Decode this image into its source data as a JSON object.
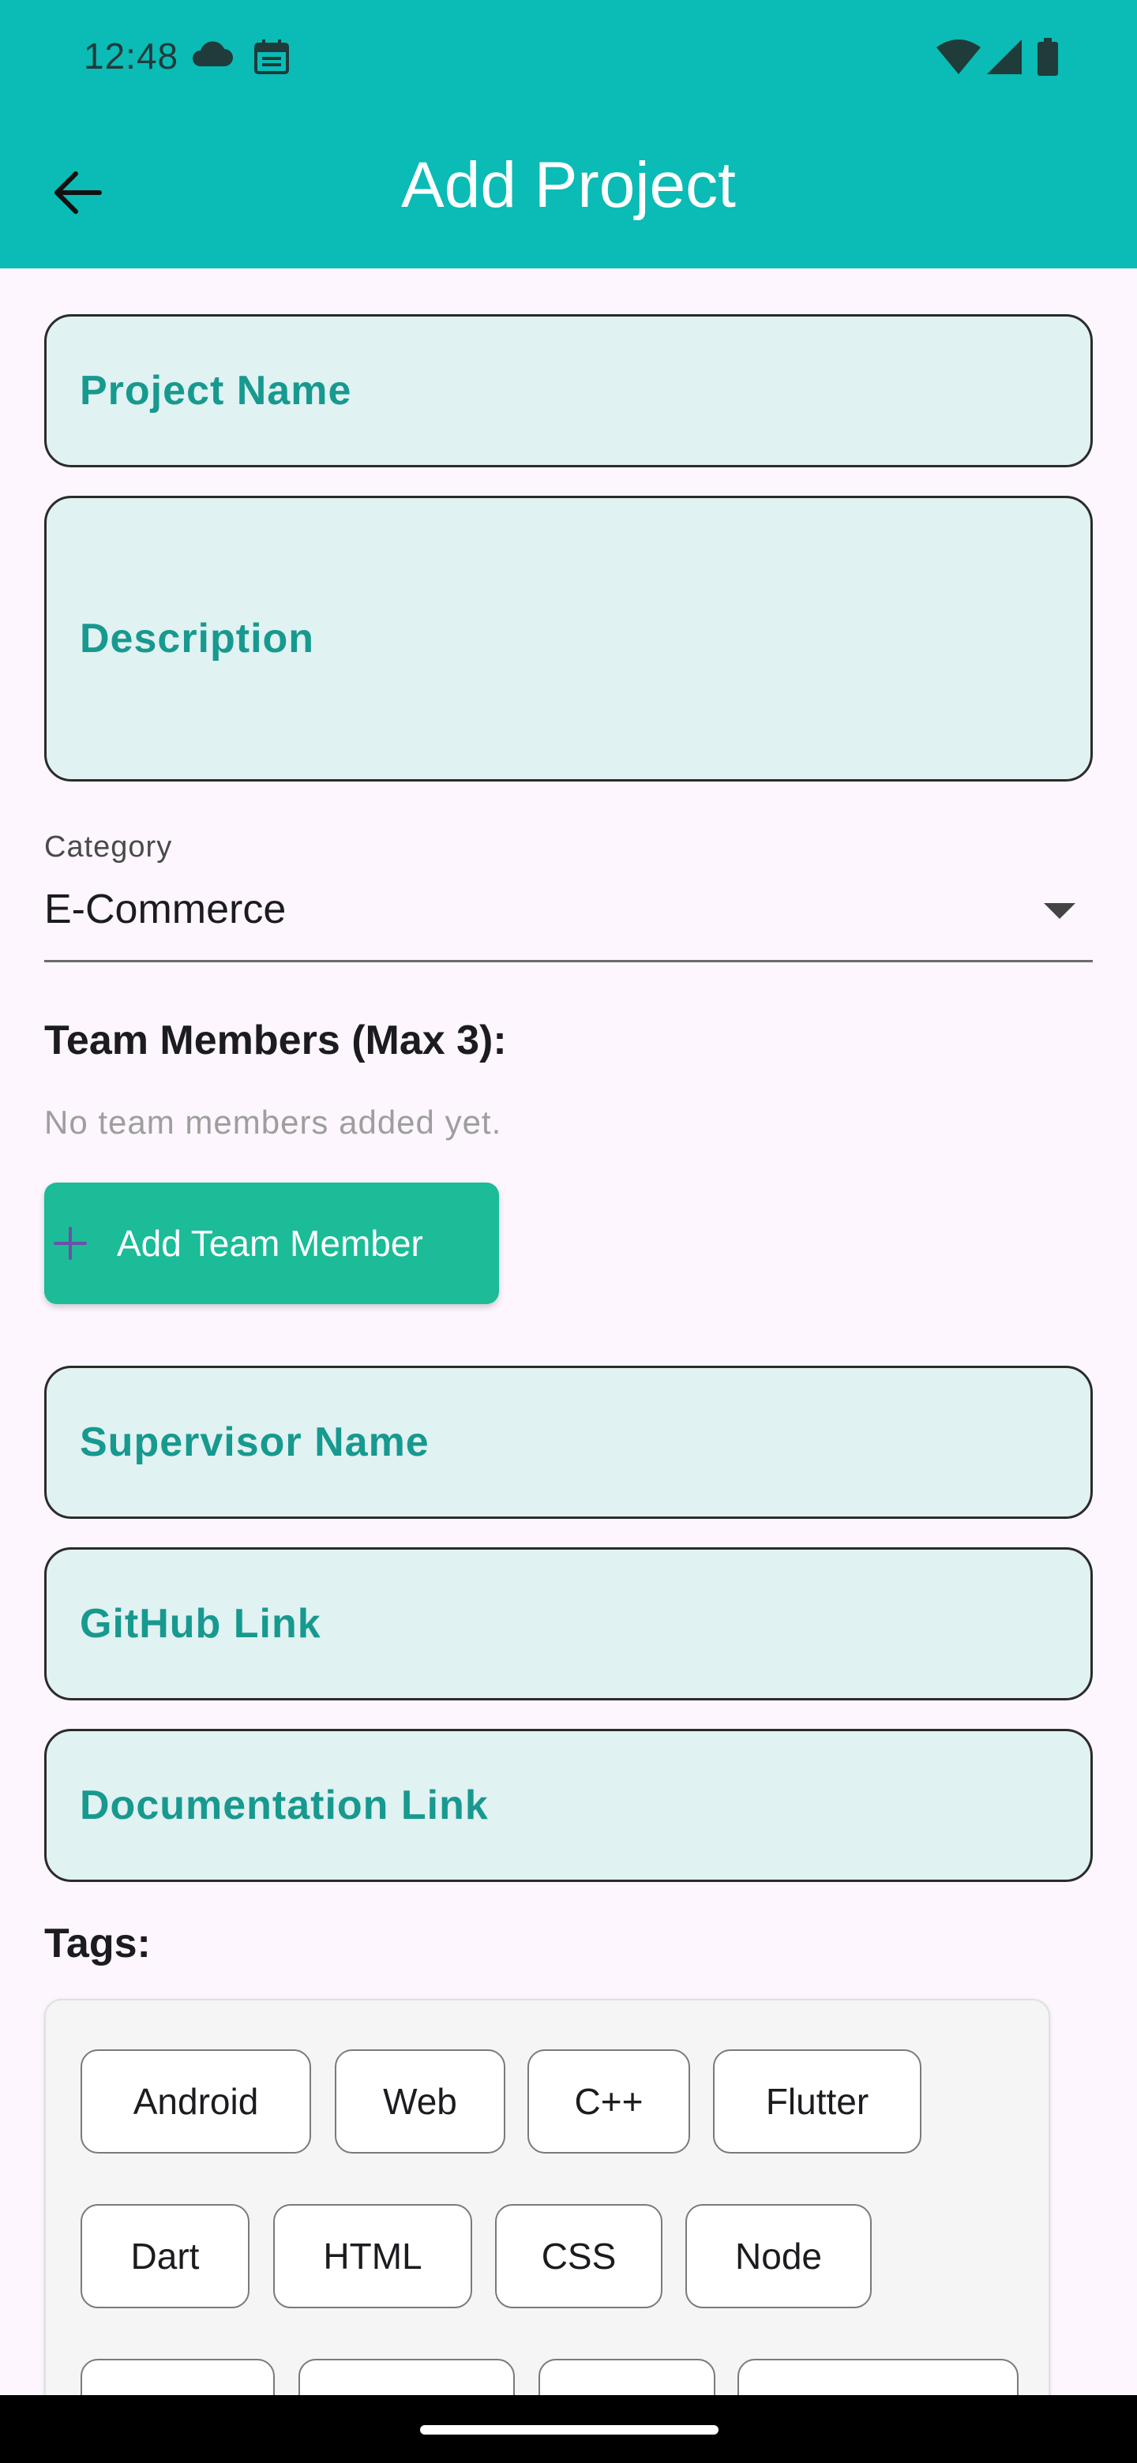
{
  "status_bar": {
    "time": "12:48"
  },
  "app_bar": {
    "title": "Add Project"
  },
  "form": {
    "project_name_label": "Project Name",
    "description_label": "Description",
    "category": {
      "label": "Category",
      "value": "E-Commerce"
    },
    "team": {
      "title": "Team Members (Max 3):",
      "empty_text": "No team members added yet.",
      "add_button": "Add Team Member"
    },
    "supervisor_label": "Supervisor Name",
    "github_label": "GitHub Link",
    "docs_label": "Documentation Link",
    "tags": {
      "title": "Tags:",
      "items": [
        "Android",
        "Web",
        "C++",
        "Flutter",
        "Dart",
        "HTML",
        "CSS",
        "Node"
      ]
    }
  },
  "colors": {
    "app_bar": "#0BBBB5",
    "field_bg": "#E0F2F1",
    "field_label": "#17998F",
    "button": "#1BBC97",
    "page_bg": "#FDF6FE"
  }
}
